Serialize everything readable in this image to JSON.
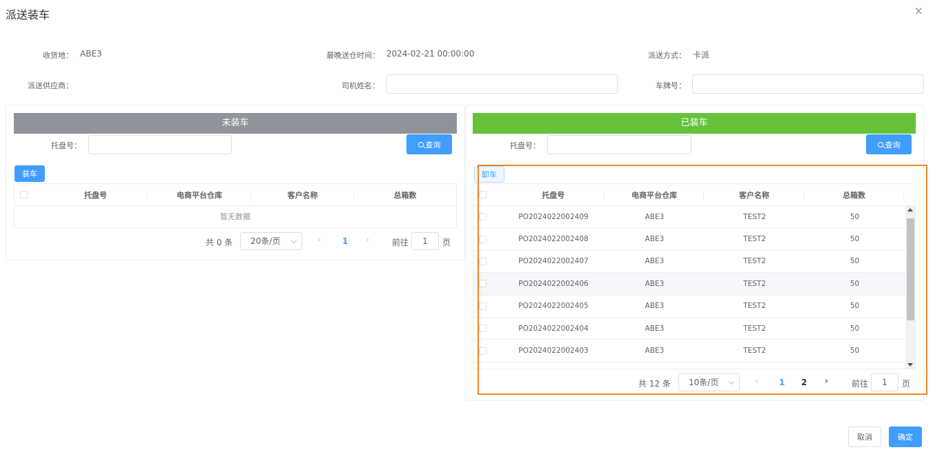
{
  "dialog": {
    "title": "派送装车",
    "close_glyph": "×"
  },
  "form": {
    "destination_label": "收货地：",
    "destination_value": "ABE3",
    "latest_delivery_label": "最晚送仓时间：",
    "latest_delivery_value": "2024-02-21 00:00:00",
    "delivery_method_label": "派送方式：",
    "delivery_method_value": "卡派",
    "supplier_label": "派送供应商：",
    "driver_label": "司机姓名：",
    "driver_value": "",
    "plate_label": "车牌号：",
    "plate_value": ""
  },
  "unloaded_panel": {
    "header": "未装车",
    "header_color": "#909399",
    "pallet_label": "托盘号：",
    "pallet_value": "",
    "search_label": "查询",
    "load_button": "装车",
    "columns": [
      "托盘号",
      "电商平台仓库",
      "客户名称",
      "总箱数"
    ],
    "empty_text": "暂无数据",
    "total_text": "共 0 条",
    "page_size": "20条/页",
    "current_page": "1",
    "goto_label": "前往",
    "goto_value": "1",
    "page_unit": "页"
  },
  "loaded_panel": {
    "header": "已装车",
    "header_color": "#67c23a",
    "pallet_label": "托盘号：",
    "pallet_value": "",
    "search_label": "查询",
    "unload_button": "卸车",
    "columns": [
      "托盘号",
      "电商平台仓库",
      "客户名称",
      "总箱数"
    ],
    "rows": [
      {
        "pallet": "PO2024022002409",
        "warehouse": "ABE3",
        "customer": "TEST2",
        "boxes": "50"
      },
      {
        "pallet": "PO2024022002408",
        "warehouse": "ABE3",
        "customer": "TEST2",
        "boxes": "50"
      },
      {
        "pallet": "PO2024022002407",
        "warehouse": "ABE3",
        "customer": "TEST2",
        "boxes": "50"
      },
      {
        "pallet": "PO2024022002406",
        "warehouse": "ABE3",
        "customer": "TEST2",
        "boxes": "50"
      },
      {
        "pallet": "PO2024022002405",
        "warehouse": "ABE3",
        "customer": "TEST2",
        "boxes": "50"
      },
      {
        "pallet": "PO2024022002404",
        "warehouse": "ABE3",
        "customer": "TEST2",
        "boxes": "50"
      },
      {
        "pallet": "PO2024022002403",
        "warehouse": "ABE3",
        "customer": "TEST2",
        "boxes": "50"
      }
    ],
    "total_text": "共 12 条",
    "page_size": "10条/页",
    "pages": [
      "1",
      "2"
    ],
    "current_page": "1",
    "goto_label": "前往",
    "goto_value": "1",
    "page_unit": "页",
    "highlight_color": "#f08427"
  },
  "footer": {
    "cancel_label": "取消",
    "confirm_label": "确定"
  },
  "colors": {
    "primary": "#409eff",
    "text": "#606266",
    "border": "#dcdfe6"
  }
}
